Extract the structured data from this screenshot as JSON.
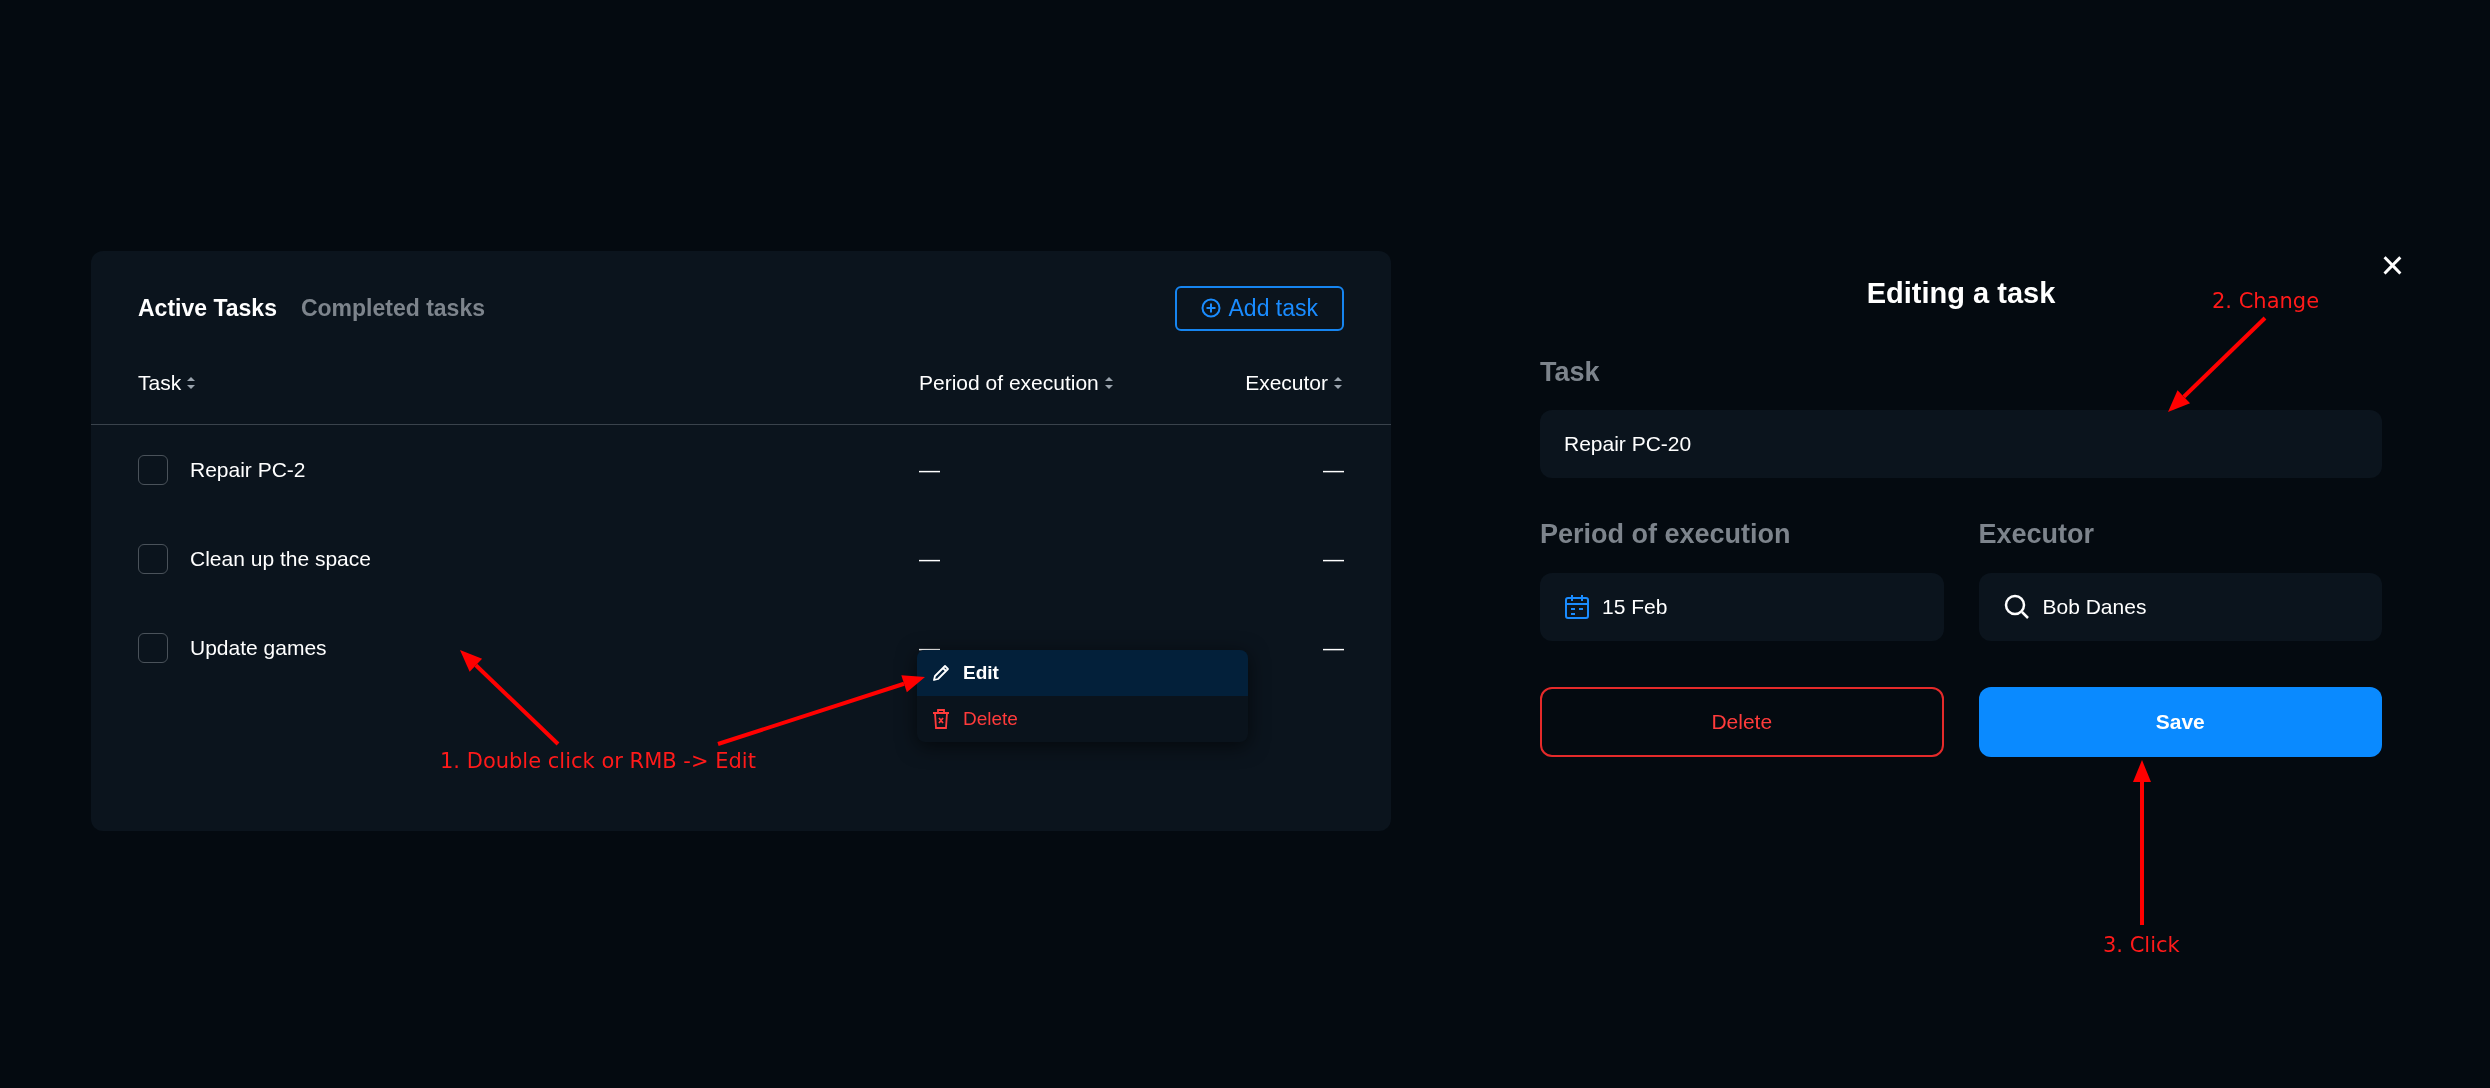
{
  "tabs": [
    {
      "label": "Active Tasks",
      "selected": true
    },
    {
      "label": "Completed tasks",
      "selected": false
    }
  ],
  "add_button": "Add task",
  "table": {
    "columns": [
      "Task",
      "Period of execution",
      "Executor"
    ],
    "rows": [
      {
        "task": "Repair PC-2",
        "period": "—",
        "executor": "—",
        "checked": false
      },
      {
        "task": "Clean up the space",
        "period": "—",
        "executor": "—",
        "checked": false
      },
      {
        "task": "Update games",
        "period": "—",
        "executor": "—",
        "checked": false
      }
    ]
  },
  "context_menu": [
    {
      "label": "Edit",
      "kind": "edit",
      "selected": true
    },
    {
      "label": "Delete",
      "kind": "delete",
      "selected": false
    }
  ],
  "dialog": {
    "title": "Editing a task",
    "close": "×",
    "task_label": "Task",
    "task_value": "Repair PC-20",
    "period_label": "Period of execution",
    "period_value": "15 Feb",
    "executor_label": "Executor",
    "executor_value": "Bob Danes",
    "buttons": [
      {
        "label": "Delete",
        "kind": "danger"
      },
      {
        "label": "Save",
        "kind": "primary"
      }
    ]
  },
  "annotations": [
    "1. Double click or RMB -> Edit",
    "2. Change",
    "3. Click"
  ]
}
